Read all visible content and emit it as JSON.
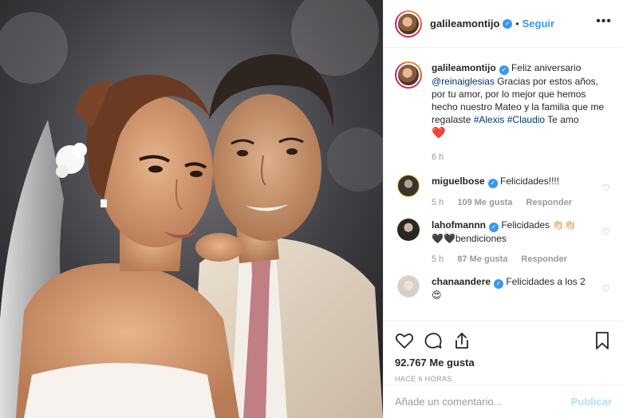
{
  "post": {
    "author": "galileamontijo",
    "follow_label": "Seguir",
    "dot": "•",
    "more_glyph": "•••"
  },
  "caption": {
    "user": "galileamontijo",
    "text_1": " Feliz aniversario ",
    "mention": "@reinaiglesias",
    "text_2": " Gracias por estos años, por tu amor, por lo mejor que hemos hecho nuestro Mateo y la familia que me regalaste ",
    "tag_1": "#Alexis",
    "tag_2": "#Claudio",
    "text_3": " Te amo",
    "heart": "❤️",
    "time": "6 h"
  },
  "comments": [
    {
      "user": "miguelbose",
      "text": "Felicidades!!!!",
      "time": "5 h",
      "likes": "109 Me gusta",
      "reply": "Responder"
    },
    {
      "user": "lahofmannn",
      "text": "Felicidades 👏🏻👏🏻 🖤🖤bendiciones",
      "time": "5 h",
      "likes": "87 Me gusta",
      "reply": "Responder"
    },
    {
      "user": "chanaandere",
      "text": "Felicidades a los 2 😍"
    }
  ],
  "footer": {
    "likes": "92.767 Me gusta",
    "time_ago": "HACE 6 HORAS",
    "comment_placeholder": "Añade un comentario...",
    "publish_label": "Publicar"
  },
  "icons": [
    "verified-badge-icon",
    "heart-icon",
    "comment-icon",
    "share-icon",
    "bookmark-icon",
    "small-heart-icon"
  ],
  "colors": {
    "accent": "#3897f0",
    "link": "#003569",
    "muted": "#999999",
    "publish_disabled": "#b2dffc"
  }
}
